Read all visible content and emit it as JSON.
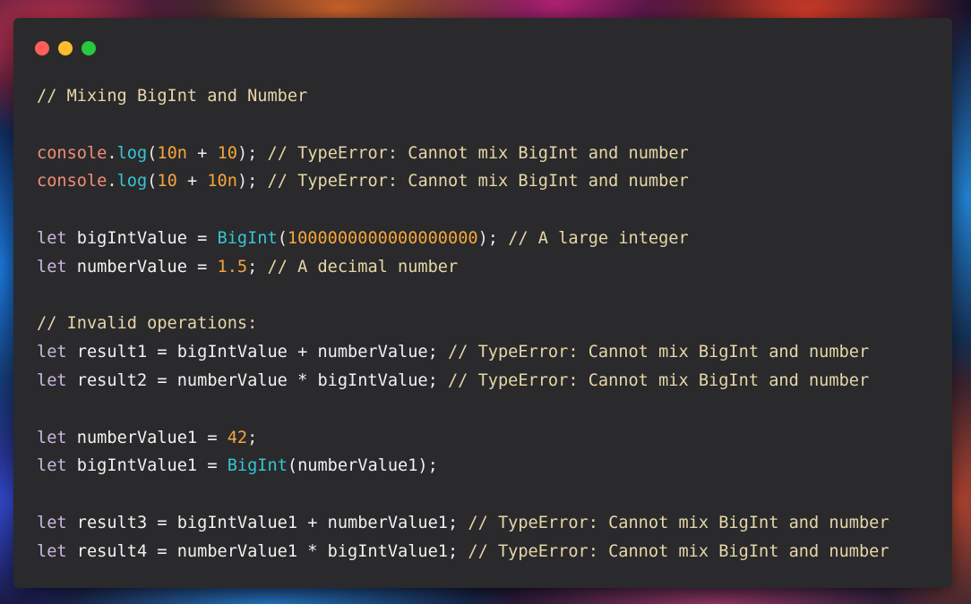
{
  "window": {
    "traffic_lights": [
      {
        "name": "close",
        "color": "#ff5f57"
      },
      {
        "name": "minimize",
        "color": "#febc2e"
      },
      {
        "name": "zoom",
        "color": "#28c840"
      }
    ]
  },
  "colors": {
    "comment": "#e7d6a8",
    "keyword": "#c9b8e0",
    "number": "#f6a63b",
    "function": "#35c6d6",
    "object": "#f08e77",
    "background": "#2a2a2c"
  },
  "code_lines": [
    [
      {
        "t": "// Mixing BigInt and Number",
        "c": "comment"
      }
    ],
    [],
    [
      {
        "t": "console",
        "c": "object"
      },
      {
        "t": ".",
        "c": "punct"
      },
      {
        "t": "log",
        "c": "func"
      },
      {
        "t": "(",
        "c": "punct"
      },
      {
        "t": "10n",
        "c": "number"
      },
      {
        "t": " + ",
        "c": "plain"
      },
      {
        "t": "10",
        "c": "number"
      },
      {
        "t": "); ",
        "c": "punct"
      },
      {
        "t": "// TypeError: Cannot mix BigInt and number",
        "c": "comment"
      }
    ],
    [
      {
        "t": "console",
        "c": "object"
      },
      {
        "t": ".",
        "c": "punct"
      },
      {
        "t": "log",
        "c": "func"
      },
      {
        "t": "(",
        "c": "punct"
      },
      {
        "t": "10",
        "c": "number"
      },
      {
        "t": " + ",
        "c": "plain"
      },
      {
        "t": "10n",
        "c": "number"
      },
      {
        "t": "); ",
        "c": "punct"
      },
      {
        "t": "// TypeError: Cannot mix BigInt and number",
        "c": "comment"
      }
    ],
    [],
    [
      {
        "t": "let",
        "c": "keyword"
      },
      {
        "t": " bigIntValue = ",
        "c": "plain"
      },
      {
        "t": "BigInt",
        "c": "func"
      },
      {
        "t": "(",
        "c": "punct"
      },
      {
        "t": "1000000000000000000",
        "c": "number"
      },
      {
        "t": "); ",
        "c": "punct"
      },
      {
        "t": "// A large integer",
        "c": "comment"
      }
    ],
    [
      {
        "t": "let",
        "c": "keyword"
      },
      {
        "t": " numberValue = ",
        "c": "plain"
      },
      {
        "t": "1.5",
        "c": "number"
      },
      {
        "t": "; ",
        "c": "punct"
      },
      {
        "t": "// A decimal number",
        "c": "comment"
      }
    ],
    [],
    [
      {
        "t": "// Invalid operations:",
        "c": "comment"
      }
    ],
    [
      {
        "t": "let",
        "c": "keyword"
      },
      {
        "t": " result1 = bigIntValue + numberValue; ",
        "c": "plain"
      },
      {
        "t": "// TypeError: Cannot mix BigInt and number",
        "c": "comment"
      }
    ],
    [
      {
        "t": "let",
        "c": "keyword"
      },
      {
        "t": " result2 = numberValue * bigIntValue; ",
        "c": "plain"
      },
      {
        "t": "// TypeError: Cannot mix BigInt and number",
        "c": "comment"
      }
    ],
    [],
    [
      {
        "t": "let",
        "c": "keyword"
      },
      {
        "t": " numberValue1 = ",
        "c": "plain"
      },
      {
        "t": "42",
        "c": "number"
      },
      {
        "t": ";",
        "c": "punct"
      }
    ],
    [
      {
        "t": "let",
        "c": "keyword"
      },
      {
        "t": " bigIntValue1 = ",
        "c": "plain"
      },
      {
        "t": "BigInt",
        "c": "func"
      },
      {
        "t": "(numberValue1);",
        "c": "plain"
      }
    ],
    [],
    [
      {
        "t": "let",
        "c": "keyword"
      },
      {
        "t": " result3 = bigIntValue1 + numberValue1; ",
        "c": "plain"
      },
      {
        "t": "// TypeError: Cannot mix BigInt and number",
        "c": "comment"
      }
    ],
    [
      {
        "t": "let",
        "c": "keyword"
      },
      {
        "t": " result4 = numberValue1 * bigIntValue1; ",
        "c": "plain"
      },
      {
        "t": "// TypeError: Cannot mix BigInt and number",
        "c": "comment"
      }
    ]
  ]
}
